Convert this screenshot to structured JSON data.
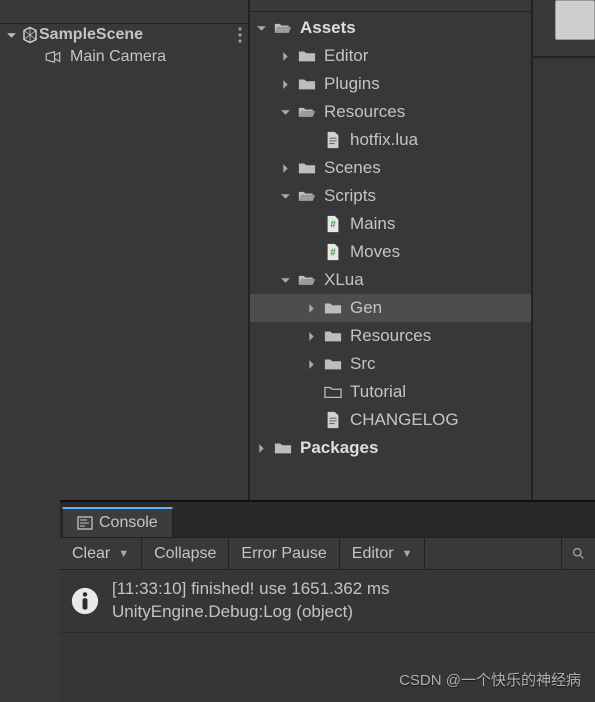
{
  "hierarchy": {
    "scene": {
      "name": "SampleScene"
    },
    "objects": [
      {
        "name": "Main Camera",
        "icon": "camera"
      }
    ]
  },
  "project": {
    "tree": [
      {
        "label": "Assets",
        "icon": "folder-open",
        "indent": 0,
        "bold": true,
        "foldout": "open"
      },
      {
        "label": "Editor",
        "icon": "folder",
        "indent": 1,
        "foldout": "closed"
      },
      {
        "label": "Plugins",
        "icon": "folder",
        "indent": 1,
        "foldout": "closed"
      },
      {
        "label": "Resources",
        "icon": "folder-open",
        "indent": 1,
        "foldout": "open"
      },
      {
        "label": "hotfix.lua",
        "icon": "text-file",
        "indent": 2,
        "foldout": "none"
      },
      {
        "label": "Scenes",
        "icon": "folder",
        "indent": 1,
        "foldout": "closed"
      },
      {
        "label": "Scripts",
        "icon": "folder-open",
        "indent": 1,
        "foldout": "open"
      },
      {
        "label": "Mains",
        "icon": "cs-file",
        "indent": 2,
        "foldout": "none"
      },
      {
        "label": "Moves",
        "icon": "cs-file",
        "indent": 2,
        "foldout": "none"
      },
      {
        "label": "XLua",
        "icon": "folder-open",
        "indent": 1,
        "foldout": "open"
      },
      {
        "label": "Gen",
        "icon": "folder",
        "indent": 2,
        "foldout": "closed",
        "selected": true
      },
      {
        "label": "Resources",
        "icon": "folder",
        "indent": 2,
        "foldout": "closed"
      },
      {
        "label": "Src",
        "icon": "folder",
        "indent": 2,
        "foldout": "closed"
      },
      {
        "label": "Tutorial",
        "icon": "folder-outline",
        "indent": 2,
        "foldout": "none"
      },
      {
        "label": "CHANGELOG",
        "icon": "text-file",
        "indent": 2,
        "foldout": "none"
      },
      {
        "label": "Packages",
        "icon": "folder",
        "indent": 0,
        "bold": true,
        "foldout": "closed"
      }
    ]
  },
  "console": {
    "tab_label": "Console",
    "toolbar": {
      "clear": "Clear",
      "collapse": "Collapse",
      "error_pause": "Error Pause",
      "editor": "Editor"
    },
    "log": {
      "line1": "[11:33:10] finished! use 1651.362 ms",
      "line2": "UnityEngine.Debug:Log (object)"
    }
  },
  "watermark": "CSDN @一个快乐的神经病"
}
